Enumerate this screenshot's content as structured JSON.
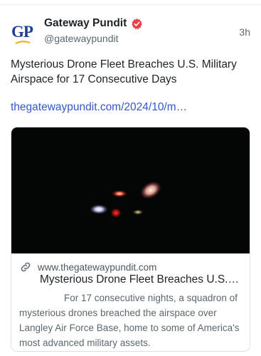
{
  "author": {
    "name": "Gateway Pundit",
    "handle": "@gatewaypundit",
    "avatar_text": "GP",
    "verified": true,
    "verified_color": "#e8424a"
  },
  "post": {
    "time": "3h",
    "text": "Mysterious Drone Fleet Breaches U.S. Military Airspace for 17 Consecutive Days",
    "link_text": "thegatewaypundit.com/2024/10/m…",
    "link_color": "#3657c9"
  },
  "card": {
    "domain": "www.thegatewaypundit.com",
    "title": "Mysterious Drone Fleet Breaches U.S.…",
    "description": "For 17 consecutive nights, a squadron of mysterious drones breached the airspace over Langley Air Force Base, home to some of America's most advanced military assets.",
    "image_description": "night-sky-drone-lights"
  },
  "icons": {
    "verified": "verified-badge-icon",
    "link": "link-chain-icon"
  }
}
